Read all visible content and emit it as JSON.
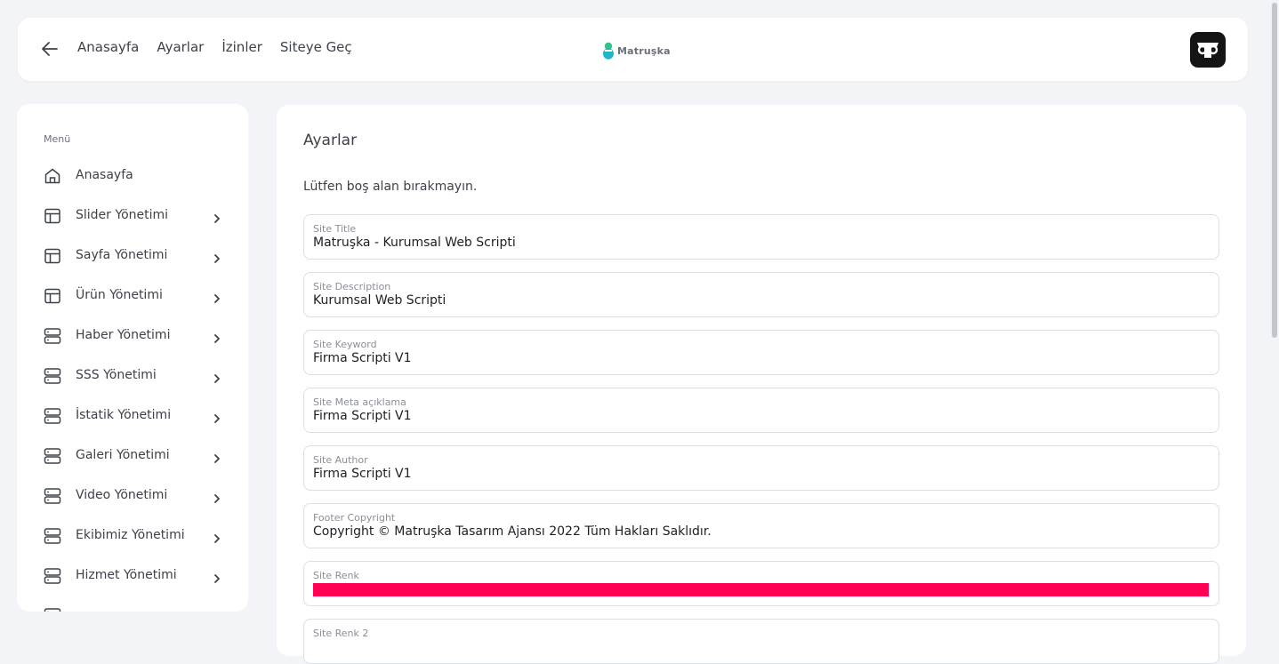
{
  "header": {
    "nav": [
      "Anasayfa",
      "Ayarlar",
      "İzinler",
      "Siteye Geç"
    ],
    "logo_text": "Matruşka"
  },
  "sidebar": {
    "title": "Menü",
    "items": [
      {
        "label": "Anasayfa",
        "icon": "home-icon",
        "has_submenu": false
      },
      {
        "label": "Slider Yönetimi",
        "icon": "layout-icon",
        "has_submenu": true
      },
      {
        "label": "Sayfa Yönetimi",
        "icon": "layout-icon",
        "has_submenu": true
      },
      {
        "label": "Ürün Yönetimi",
        "icon": "layout-icon",
        "has_submenu": true
      },
      {
        "label": "Haber Yönetimi",
        "icon": "server-icon",
        "has_submenu": true
      },
      {
        "label": "SSS Yönetimi",
        "icon": "server-icon",
        "has_submenu": true
      },
      {
        "label": "İstatik Yönetimi",
        "icon": "server-icon",
        "has_submenu": true
      },
      {
        "label": "Galeri Yönetimi",
        "icon": "server-icon",
        "has_submenu": true
      },
      {
        "label": "Video Yönetimi",
        "icon": "server-icon",
        "has_submenu": true
      },
      {
        "label": "Ekibimiz Yönetimi",
        "icon": "server-icon",
        "has_submenu": true
      },
      {
        "label": "Hizmet Yönetimi",
        "icon": "server-icon",
        "has_submenu": true
      },
      {
        "label": "",
        "icon": "server-icon",
        "has_submenu": true
      }
    ]
  },
  "main": {
    "title": "Ayarlar",
    "notice": "Lütfen boş alan bırakmayın.",
    "fields": [
      {
        "label": "Site Title",
        "value": "Matruşka - Kurumsal Web Scripti"
      },
      {
        "label": "Site Description",
        "value": "Kurumsal Web Scripti"
      },
      {
        "label": "Site Keyword",
        "value": "Firma Scripti V1"
      },
      {
        "label": "Site Meta açıklama",
        "value": "Firma Scripti V1"
      },
      {
        "label": "Site Author",
        "value": "Firma Scripti V1"
      },
      {
        "label": "Footer Copyright",
        "value": "Copyright © Matruşka Tasarım Ajansı 2022  Tüm Hakları Saklıdır."
      },
      {
        "label": "Site Renk",
        "color": "#ff0052"
      },
      {
        "label": "Site Renk 2",
        "value": ""
      }
    ]
  },
  "colors": {
    "background": "#f3f4f7",
    "panel": "#ffffff",
    "logo_accent": "#1fb6c9",
    "site_color": "#ff0052"
  }
}
